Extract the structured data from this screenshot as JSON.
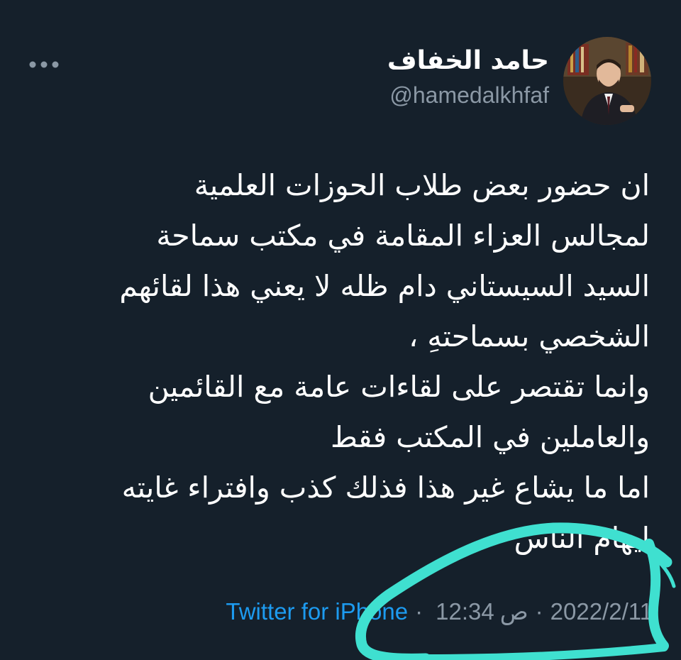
{
  "author": {
    "display_name": "حامد الخفاف",
    "handle": "@hamedalkhfaf"
  },
  "tweet": {
    "lines": [
      "ان حضور بعض طلاب الحوزات العلمية",
      "لمجالس العزاء المقامة في مكتب سماحة",
      "السيد السيستاني دام ظله لا يعني هذا لقائهم",
      "الشخصي بسماحتهِ ،",
      "وانما تقتصر على لقاءات عامة مع القائمين",
      "والعاملين في المكتب فقط",
      "اما ما يشاع غير هذا فذلك كذب وافتراء غايته",
      "ايهام الناس"
    ]
  },
  "meta": {
    "date": "2022/2/11",
    "time": "12:34",
    "period": "ص",
    "separator": "·",
    "source": "Twitter for iPhone"
  },
  "icons": {
    "more": "more-horizontal-icon"
  },
  "colors": {
    "background": "#15202b",
    "text_primary": "#ffffff",
    "text_secondary": "#8b98a5",
    "link": "#1d9bf0",
    "annotation_marker": "#3fe0d0"
  }
}
